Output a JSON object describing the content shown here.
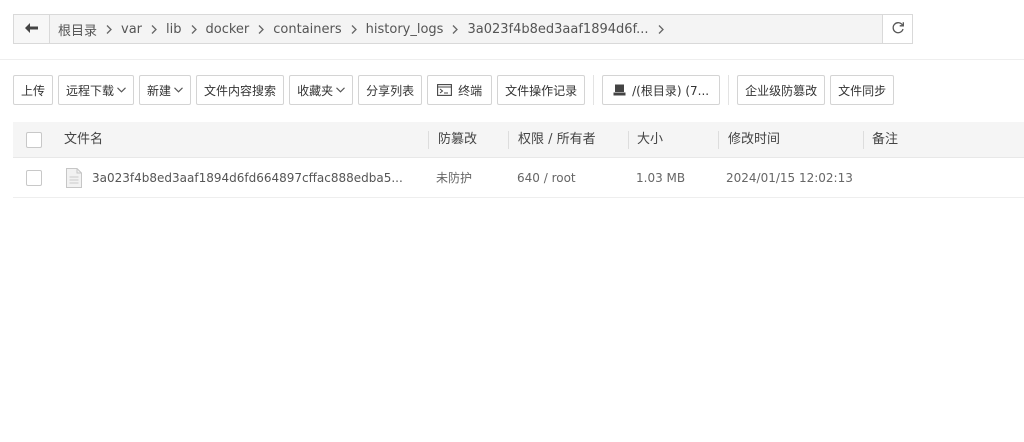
{
  "breadcrumb": {
    "back_icon": "arrow-left-icon",
    "items": [
      "根目录",
      "var",
      "lib",
      "docker",
      "containers",
      "history_logs",
      "3a023f4b8ed3aaf1894d6f..."
    ],
    "separator_icon": "chevron-right-icon",
    "refresh_icon": "refresh-icon"
  },
  "toolbar": {
    "upload": "上传",
    "remote_download": "远程下载",
    "new": "新建",
    "content_search": "文件内容搜索",
    "favorites": "收藏夹",
    "share_list": "分享列表",
    "terminal": "终端",
    "op_log": "文件操作记录",
    "disk": "/(根目录) (7...",
    "tamper_proof": "企业级防篡改",
    "file_sync": "文件同步"
  },
  "table": {
    "columns": [
      "文件名",
      "防篡改",
      "权限 / 所有者",
      "大小",
      "修改时间",
      "备注"
    ],
    "rows": [
      {
        "name": "3a023f4b8ed3aaf1894d6fd664897cffac888edba5...",
        "tamper": "未防护",
        "perm_owner": "640 / root",
        "size": "1.03 MB",
        "mtime": "2024/01/15 12:02:13",
        "note": ""
      }
    ]
  },
  "colors": {
    "border": "#d9d9d9",
    "header_bg": "#f5f5f5",
    "crumb_bg": "#f4f4f4"
  }
}
